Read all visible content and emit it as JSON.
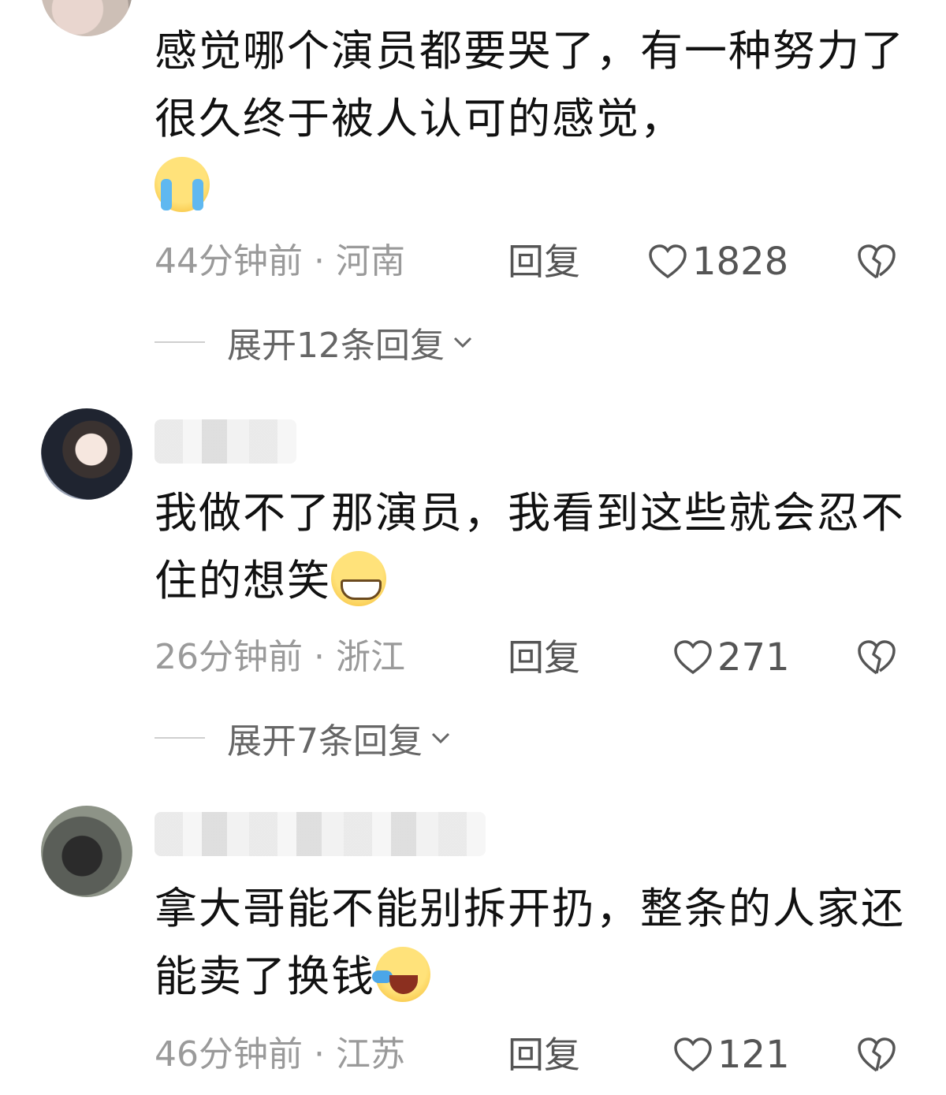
{
  "comments": [
    {
      "text": "感觉哪个演员都要哭了，有一种努力了很久终于被人认可的感觉，",
      "emoji": "crying-face",
      "time": "44分钟前",
      "location": "河南",
      "reply_label": "回复",
      "likes": "1828",
      "expand_label": "展开12条回复"
    },
    {
      "text": "我做不了那演员，我看到这些就会忍不住的想笑",
      "emoji": "grinning-face",
      "time": "26分钟前",
      "location": "浙江",
      "reply_label": "回复",
      "likes": "271",
      "expand_label": "展开7条回复"
    },
    {
      "text": "拿大哥能不能别拆开扔，整条的人家还能卖了换钱",
      "emoji": "rolling-laughing-face",
      "time": "46分钟前",
      "location": "江苏",
      "reply_label": "回复",
      "likes": "121"
    }
  ],
  "separator": " · "
}
